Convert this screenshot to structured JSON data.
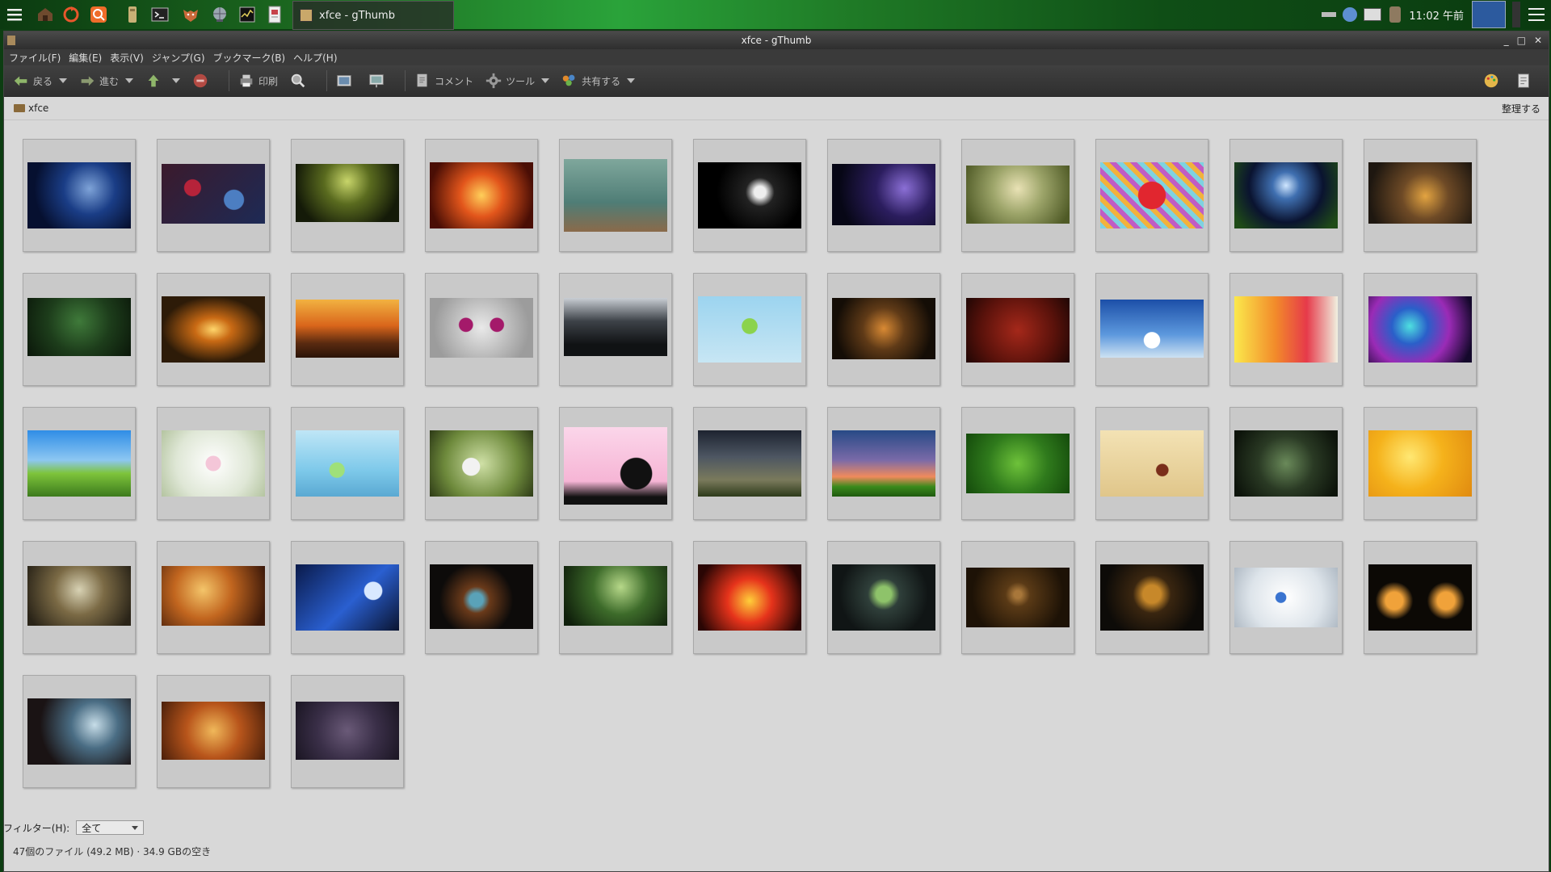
{
  "taskbar": {
    "window_title": "xfce - gThumb",
    "clock": "11:02 午前"
  },
  "window": {
    "title": "xfce - gThumb"
  },
  "menu": [
    "ファイル(F)",
    "編集(E)",
    "表示(V)",
    "ジャンプ(G)",
    "ブックマーク(B)",
    "ヘルプ(H)"
  ],
  "toolbar": {
    "back_label": "戻る",
    "forward_label": "進む",
    "print_label": "印刷",
    "comment_label": "コメント",
    "tools_label": "ツール",
    "share_label": "共有する"
  },
  "location": {
    "folder": "xfce",
    "organize_label": "整理する"
  },
  "filter": {
    "label": "フィルター(H):",
    "value": "全て"
  },
  "status": "47個のファイル (49.2 MB) · 34.9 GBの空き"
}
